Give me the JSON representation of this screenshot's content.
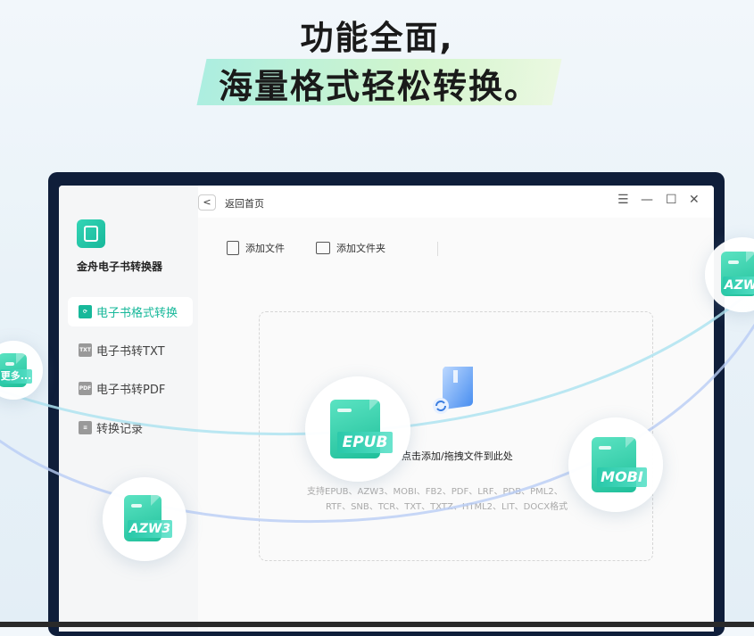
{
  "headline": {
    "line1": "功能全面,",
    "line2": "海量格式轻松转换。"
  },
  "app": {
    "name": "金舟电子书转换器",
    "accent_color": "#17b89a"
  },
  "sidebar": {
    "items": [
      {
        "label": "电子书格式转换",
        "icon": "refresh-book-icon",
        "active": true
      },
      {
        "label": "电子书转TXT",
        "icon": "txt-file-icon",
        "icon_text": "TXT",
        "active": false
      },
      {
        "label": "电子书转PDF",
        "icon": "pdf-file-icon",
        "icon_text": "PDF",
        "active": false
      },
      {
        "label": "转换记录",
        "icon": "list-icon",
        "active": false
      }
    ]
  },
  "topbar": {
    "back_label": "返回首页",
    "back_glyph": "<",
    "menu_glyph": "☰",
    "minimize_glyph": "—",
    "maximize_glyph": "☐",
    "close_glyph": "✕"
  },
  "toolbar": {
    "add_file": "添加文件",
    "add_folder": "添加文件夹"
  },
  "dropzone": {
    "label": "点击添加/拖拽文件到此处",
    "formats_line1": "支持EPUB、AZW3、MOBI、FB2、PDF、LRF、PDB、PML2、",
    "formats_line2": "RTF、SNB、TCR、TXT、TXTZ、HTML2、LIT、DOCX格式"
  },
  "format_badges": {
    "epub": "EPUB",
    "mobi": "MOBI",
    "azw3": "AZW3",
    "azw_partial": "AZW",
    "more": "更多..."
  }
}
